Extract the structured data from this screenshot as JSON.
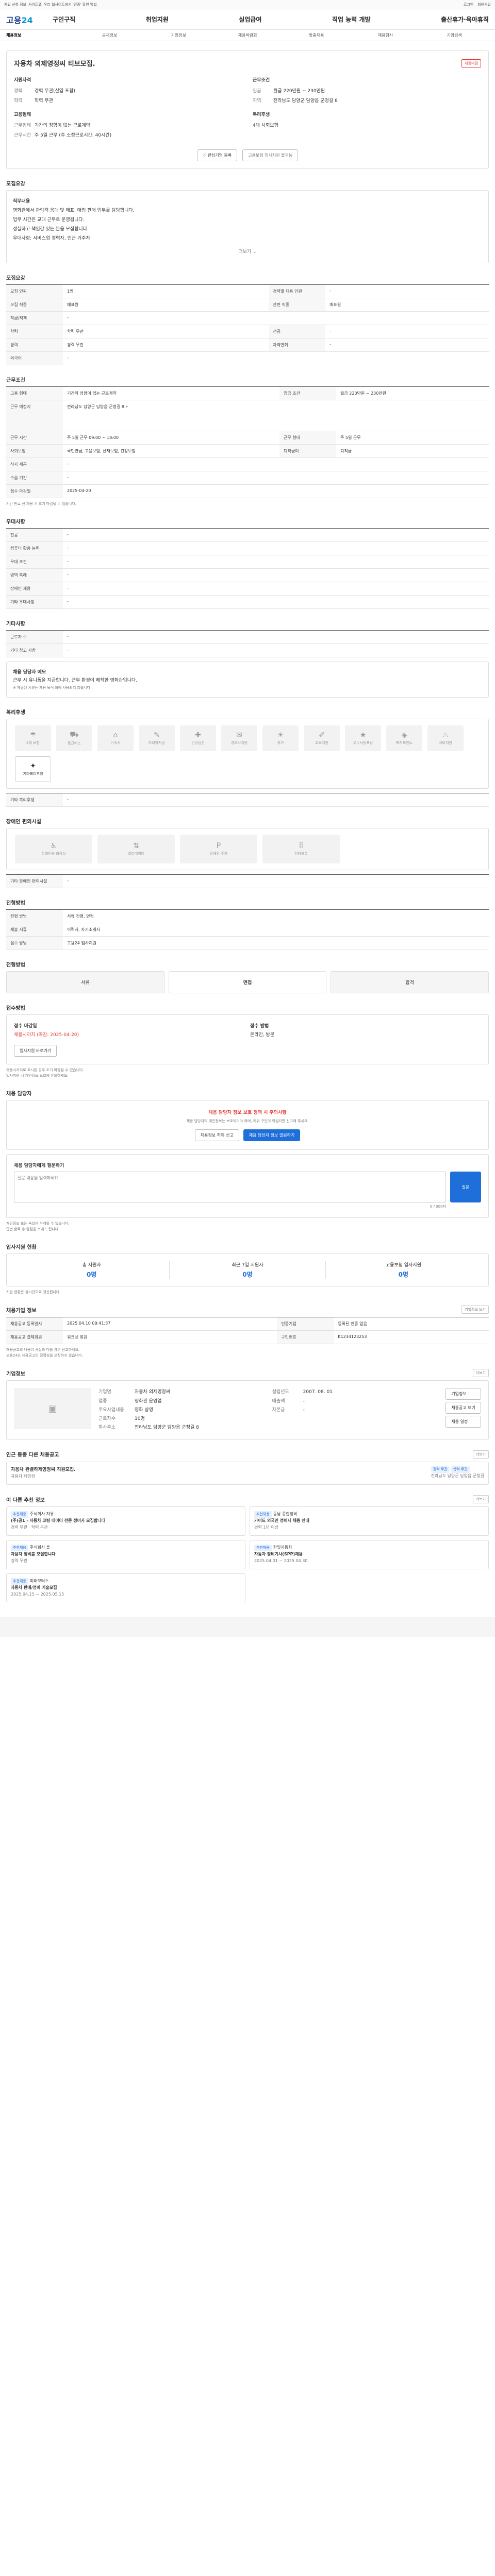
{
  "topbar": {
    "left": [
      "자립 신청 정보",
      "사이트맵",
      "우리 웹사이트에서 '인증' 확인 방법"
    ],
    "right": [
      "로그인",
      "회원가입"
    ]
  },
  "header": {
    "logo": "고용24",
    "user": [
      "로그인",
      "회원가입"
    ]
  },
  "nav": {
    "brand_a": "고용",
    "brand_b": "24",
    "menu": [
      "구인구직",
      "취업지원",
      "실업급여",
      "직업 능력 개발",
      "출산휴가·육아휴직"
    ]
  },
  "subnav": [
    "채용정보",
    "공채정보",
    "기업정보",
    "채용박람회",
    "맞춤채용",
    "채용행사",
    "기업검색"
  ],
  "job": {
    "company": "자용차 외제영정씨 티브모집.",
    "badge": "채용마감",
    "left_k": [
      "지원자격",
      "경력",
      "학력",
      "고용형태",
      "근무형태",
      "근무시간"
    ],
    "left_v": [
      "",
      "경력 무관(신입 포함)",
      "학력 무관",
      "",
      "기간의 정함이 없는 근로계약",
      "주 5일 근무 (주 소정근로시간: 40시간)"
    ],
    "right_k": [
      "근무조건",
      "임금",
      "지역",
      "복리후생"
    ],
    "right_v": [
      "",
      "월급 220만원 ~ 230만원",
      "전라남도 담양군 담양읍 군청길 8",
      "4대 사회보험"
    ],
    "btn_a": "관심기업 등록",
    "btn_b": "고용보험 입사지원 불가능"
  },
  "desc": {
    "title": "모집요강",
    "lines": [
      "직무내용",
      "영화관에서 관람객 응대 및 매표, 매점 판매 업무를 담당합니다.",
      "업무 시간은 교대 근무로 운영됩니다.",
      "성실하고 책임감 있는 분을 모집합니다.",
      "우대사항: 서비스업 경력자, 인근 거주자"
    ],
    "more": "더보기"
  },
  "recruit": {
    "title": "모집요강",
    "rows": [
      [
        "모집 인원",
        "1명",
        "경력별 채용 인원",
        "-"
      ],
      [
        "모집 직종",
        "매표원",
        "관련 직종",
        "매표원"
      ],
      [
        "직급/직책",
        "-",
        "",
        ""
      ],
      [
        "학력",
        "학력 무관",
        "전공",
        "-"
      ],
      [
        "경력",
        "경력 무관",
        "자격면허",
        "-"
      ],
      [
        "외국어",
        "-",
        "",
        ""
      ]
    ]
  },
  "work": {
    "title": "근무조건",
    "rows": [
      [
        "고용 형태",
        "기간의 정함이 없는 근로계약",
        "임금 조건",
        "월급 220만원 ~ 230만원"
      ],
      [
        "근무 예정지",
        "전라남도 담양군 담양읍 군청길 8",
        "",
        ""
      ],
      [
        "근무 시간",
        "주 5일 근무 09:00 ~ 18:00",
        "근무 형태",
        "주 5일 근무"
      ],
      [
        "사회보험",
        "국민연금, 고용보험, 산재보험, 건강보험",
        "퇴직급여",
        "퇴직금"
      ],
      [
        "식사 제공",
        "-",
        "",
        ""
      ],
      [
        "수습 기간",
        "-",
        "",
        ""
      ],
      [
        "접수 마감일",
        "2025-04-20",
        "",
        ""
      ]
    ],
    "note": "기간 만료 전 채용 시 조기 마감될 수 있습니다."
  },
  "extra": {
    "title": "우대사항",
    "rows": [
      [
        "전공",
        "-"
      ],
      [
        "컴퓨터 활용 능력",
        "-"
      ],
      [
        "우대 조건",
        "-"
      ],
      [
        "병역 특례",
        "-"
      ],
      [
        "장애인 채용",
        "-"
      ],
      [
        "기타 우대사항",
        "-"
      ]
    ]
  },
  "misc": {
    "title": "기타사항",
    "rows": [
      [
        "근로자 수",
        "-"
      ],
      [
        "기타 참고 사항",
        "-"
      ]
    ],
    "memo_title": "채용 담당자 메모",
    "memo": "근무 시 유니폼을 지급합니다. 근무 환경이 쾌적한 영화관입니다.",
    "memo_note": "※ 제출된 서류는 채용 목적 외에 사용되지 않습니다."
  },
  "welfare": {
    "title": "복리후생",
    "items": [
      "4대 보험",
      "통근버스",
      "기숙사",
      "자녀학자금",
      "건강검진",
      "경조사지원",
      "휴가",
      "교육지원",
      "우수사원포상",
      "복지포인트",
      "식비지원",
      "기타복리후생"
    ],
    "active": [
      11
    ],
    "extra": "기타 복리후생",
    "extra_v": "-"
  },
  "disability": {
    "title": "장애인 편의시설",
    "items": [
      "장애인용 화장실",
      "엘리베이터",
      "장애인 주차",
      "점자블록"
    ],
    "sub": "기타 장애인 편의시설",
    "sub_v": "-"
  },
  "process": {
    "title": "전형방법",
    "rows": [
      [
        "전형 방법",
        "서류 전형, 면접"
      ],
      [
        "제출 서류",
        "이력서, 자기소개서"
      ],
      [
        "접수 방법",
        "고용24 입사지원"
      ]
    ]
  },
  "recr": {
    "title": "전형방법",
    "steps": [
      "서류",
      "면접",
      "합격"
    ]
  },
  "apply": {
    "title": "접수방법",
    "left": [
      "접수 마감일",
      "채용시까지 (마감: 2025-04-20)"
    ],
    "right": [
      "접수 방법",
      "온라인, 방문"
    ],
    "btn": "입사지원 바로가기",
    "notes": [
      "채용시까지로 표시된 경우 조기 마감될 수 있습니다.",
      "입사지원 시 개인정보 보호에 유의하세요."
    ]
  },
  "contact": {
    "title": "채용 담당자",
    "alert": "채용 담당자 정보 보호 정책 시 주의사항",
    "desc": "채용 담당자의 개인정보는 보호되어야 하며, 허위 구인이 의심되면 신고해 주세요.",
    "btn_a": "채용정보 허위 신고",
    "btn_b": "채용 담당자 정보 열람하기",
    "ask_title": "채용 담당자에게 질문하기",
    "ask_ph": "질문 내용을 입력하세요.",
    "ask_btn": "질문",
    "counter": "0 / 300자",
    "rules": [
      "개인정보 또는 욕설은 삭제될 수 있습니다.",
      "답변 완료 후 알림을 보내 드립니다."
    ]
  },
  "stats": {
    "title": "입사지원 현황",
    "items": [
      [
        "총 지원자",
        "0명"
      ],
      [
        "최근 7일 지원자",
        "0명"
      ],
      [
        "고용보험 입사지원",
        "0명"
      ]
    ],
    "note": "지원 현황은 실시간으로 갱신됩니다."
  },
  "info": {
    "title": "채용기업 정보",
    "rows": [
      [
        "채용공고 등록일시",
        "2025.04.10 09:41:37",
        "인증기업",
        "등록된 인증 없음"
      ],
      [
        "채용공고 결제회원",
        "워크넷 회원",
        "구인번호",
        "K1234123253"
      ]
    ],
    "btn": "기업정보 보기",
    "notes": [
      "채용공고의 내용이 사실과 다를 경우 신고하세요.",
      "고용24는 채용공고의 정확성을 보장하지 않습니다."
    ]
  },
  "company": {
    "title": "기업정보",
    "more": "더보기",
    "rows": [
      [
        "기업명",
        "자용차 외제영정씨"
      ],
      [
        "업종",
        "영화관 운영업"
      ],
      [
        "주요사업내용",
        "영화 상영"
      ],
      [
        "근로자수",
        "10명"
      ],
      [
        "회사주소",
        "전라남도 담양군 담양읍 군청길 8"
      ]
    ],
    "right": [
      [
        "설립년도",
        "2007. 08. 01"
      ],
      [
        "매출액",
        "-"
      ],
      [
        "자본금",
        "-"
      ]
    ],
    "btn_a": "기업정보",
    "btn_b": "채용공고 보기",
    "btn_c": "채용 일정"
  },
  "similar": {
    "title": "인근 동종 다른 채용공고",
    "more": "더보기",
    "name": "자용차 완결하제영정씨 직원모집.",
    "tags": [
      "경력 무관",
      "학력 무관"
    ],
    "company": "자용차 제영정",
    "addr": "전라남도 담양군 담양읍 군청길"
  },
  "recommend": {
    "title": "이 다른 추천 정보",
    "more": "더보기",
    "items": [
      {
        "badge": "추천채용",
        "company": "주식회사 자유",
        "title": "(주)공1 - 자동차 코팅 데이터 전문 정비사 모집합니다",
        "meta": "경력 무관 · 학력 무관"
      },
      {
        "badge": "추천채용",
        "company": "동남 종합정비",
        "title": "가이드 외국인 정비사 채용 안내",
        "meta": "경력 1년 이상"
      },
      {
        "badge": "추천채용",
        "company": "주식회사 올",
        "title": "자용차 정비를 모집합니다",
        "meta": "경력 무관"
      },
      {
        "badge": "추천채용",
        "company": "한빛자동차",
        "title": "자동차 정비기사(SPP)채용",
        "meta": "2025.04.01 ~ 2025.04.30"
      },
      {
        "badge": "추천채용",
        "company": "미래모터스",
        "title": "자동차 판매/정비 기술모집",
        "meta": "2025.04.15 ~ 2025.05.15"
      }
    ]
  }
}
